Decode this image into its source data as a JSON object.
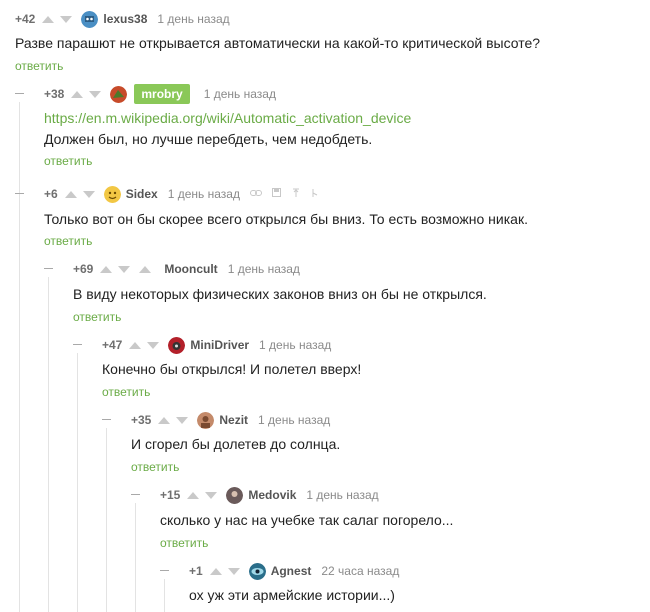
{
  "comments": [
    {
      "rating": "+42",
      "author": "lexus38",
      "time": "1 день назад",
      "text": "Разве парашют не открывается автоматически на какой-то критической высоте?",
      "reply": "ответить",
      "avatar_color": "#4a8fc4"
    },
    {
      "rating": "+38",
      "author": "mrobry",
      "time": "1 день назад",
      "link": "https://en.m.wikipedia.org/wiki/Automatic_activation_device",
      "text": "Должен был, но лучше перебдеть, чем недобдеть.",
      "reply": "ответить",
      "avatar_color": "#c74b2a",
      "badge_color": "#8ac858"
    },
    {
      "rating": "+6",
      "author": "Sidex",
      "time": "1 день назад",
      "text": "Только вот он бы скорее всего открылся бы вниз. То есть возможно никак.",
      "reply": "ответить",
      "avatar_color": "#f2c744"
    },
    {
      "rating": "+69",
      "author": "Mooncult",
      "time": "1 день назад",
      "text": "В виду некоторых физических законов вниз он бы не открылся.",
      "reply": "ответить"
    },
    {
      "rating": "+47",
      "author": "MiniDriver",
      "time": "1 день назад",
      "text": "Конечно бы открылся! И полетел вверх!",
      "reply": "ответить",
      "avatar_color": "#b3202a"
    },
    {
      "rating": "+35",
      "author": "Nezit",
      "time": "1 день назад",
      "text": "И сгорел бы долетев до солнца.",
      "reply": "ответить",
      "avatar_color": "#c48a6a"
    },
    {
      "rating": "+15",
      "author": "Medovik",
      "time": "1 день назад",
      "text": "сколько у нас на учебке так салаг погорело...",
      "reply": "ответить",
      "avatar_color": "#6a5a5a"
    },
    {
      "rating": "+1",
      "author": "Agnest",
      "time": "22 часа назад",
      "text": "ох уж эти армейские истории...)",
      "avatar_color": "#2a6e8a"
    }
  ],
  "icons": {
    "up": "arrow-up-icon",
    "down": "arrow-down-icon",
    "link": "link-icon",
    "save": "save-icon",
    "share": "share-icon",
    "more": "more-icon"
  },
  "colors": {
    "accent": "#6aab46",
    "muted": "#8a8a8a"
  }
}
